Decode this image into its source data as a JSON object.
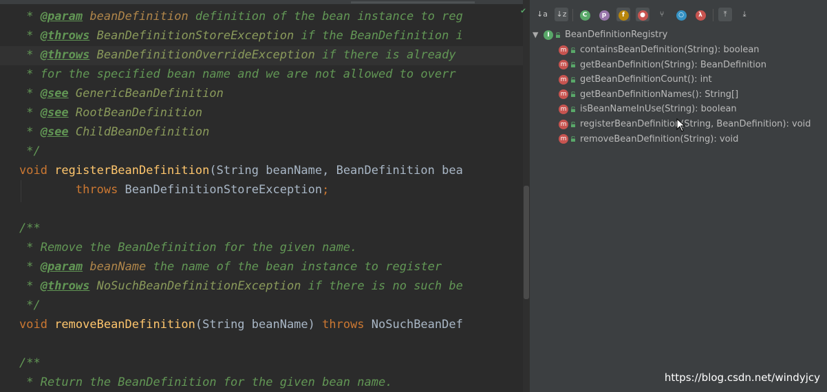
{
  "editor": {
    "lines": [
      {
        "parts": [
          {
            "c": "doc",
            "t": " * "
          },
          {
            "c": "tag",
            "t": "@param"
          },
          {
            "c": "doc",
            "t": " "
          },
          {
            "c": "param-name",
            "t": "beanDefinition"
          },
          {
            "c": "doc",
            "t": " definition of the bean instance to reg"
          }
        ]
      },
      {
        "parts": [
          {
            "c": "doc",
            "t": " * "
          },
          {
            "c": "tag",
            "t": "@throws"
          },
          {
            "c": "doc",
            "t": " "
          },
          {
            "c": "tagref",
            "t": "BeanDefinitionStoreException"
          },
          {
            "c": "doc",
            "t": " if the BeanDefinition i"
          }
        ]
      },
      {
        "parts": [
          {
            "c": "doc",
            "t": " * "
          },
          {
            "c": "tag",
            "t": "@throws"
          },
          {
            "c": "doc",
            "t": " "
          },
          {
            "c": "tagref",
            "t": "BeanDefinitionOverrideException"
          },
          {
            "c": "doc",
            "t": " if there is already"
          }
        ]
      },
      {
        "parts": [
          {
            "c": "doc",
            "t": " * for the specified bean name and we are not allowed to overr"
          }
        ]
      },
      {
        "parts": [
          {
            "c": "doc",
            "t": " * "
          },
          {
            "c": "tag",
            "t": "@see"
          },
          {
            "c": "doc",
            "t": " "
          },
          {
            "c": "tagref",
            "t": "GenericBeanDefinition"
          }
        ]
      },
      {
        "parts": [
          {
            "c": "doc",
            "t": " * "
          },
          {
            "c": "tag",
            "t": "@see"
          },
          {
            "c": "doc",
            "t": " "
          },
          {
            "c": "tagref",
            "t": "RootBeanDefinition"
          }
        ]
      },
      {
        "parts": [
          {
            "c": "doc",
            "t": " * "
          },
          {
            "c": "tag",
            "t": "@see"
          },
          {
            "c": "doc",
            "t": " "
          },
          {
            "c": "tagref",
            "t": "ChildBeanDefinition"
          }
        ]
      },
      {
        "parts": [
          {
            "c": "doc",
            "t": " */"
          }
        ]
      },
      {
        "parts": [
          {
            "c": "kw",
            "t": "void "
          },
          {
            "c": "fn",
            "t": "registerBeanDefinition"
          },
          {
            "c": "plain",
            "t": "(String beanName, BeanDefinition bea"
          }
        ]
      },
      {
        "parts": [
          {
            "c": "plain",
            "t": "        "
          },
          {
            "c": "kw",
            "t": "throws "
          },
          {
            "c": "plain",
            "t": "BeanDefinitionStoreException"
          },
          {
            "c": "kw",
            "t": ";"
          }
        ]
      },
      {
        "parts": [
          {
            "c": "plain",
            "t": ""
          }
        ]
      },
      {
        "parts": [
          {
            "c": "doc",
            "t": "/**"
          }
        ]
      },
      {
        "parts": [
          {
            "c": "doc",
            "t": " * Remove the BeanDefinition for the given name."
          }
        ]
      },
      {
        "parts": [
          {
            "c": "doc",
            "t": " * "
          },
          {
            "c": "tag",
            "t": "@param"
          },
          {
            "c": "doc",
            "t": " "
          },
          {
            "c": "param-name",
            "t": "beanName"
          },
          {
            "c": "doc",
            "t": " the name of the bean instance to register"
          }
        ]
      },
      {
        "parts": [
          {
            "c": "doc",
            "t": " * "
          },
          {
            "c": "tag",
            "t": "@throws"
          },
          {
            "c": "doc",
            "t": " "
          },
          {
            "c": "tagref",
            "t": "NoSuchBeanDefinitionException"
          },
          {
            "c": "doc",
            "t": " if there is no such be"
          }
        ]
      },
      {
        "parts": [
          {
            "c": "doc",
            "t": " */"
          }
        ]
      },
      {
        "parts": [
          {
            "c": "kw",
            "t": "void "
          },
          {
            "c": "fn",
            "t": "removeBeanDefinition"
          },
          {
            "c": "plain",
            "t": "(String beanName) "
          },
          {
            "c": "kw",
            "t": "throws "
          },
          {
            "c": "plain",
            "t": "NoSuchBeanDef"
          }
        ]
      },
      {
        "parts": [
          {
            "c": "plain",
            "t": ""
          }
        ]
      },
      {
        "parts": [
          {
            "c": "doc",
            "t": "/**"
          }
        ]
      },
      {
        "parts": [
          {
            "c": "doc",
            "t": " * Return the BeanDefinition for the given bean name."
          }
        ]
      }
    ]
  },
  "structure": {
    "root": {
      "label": "BeanDefinitionRegistry",
      "expanded_glyph": "▼",
      "icon": "interface-icon",
      "icon_letter": "I"
    },
    "method_icon_letter": "m",
    "items": [
      {
        "label": "containsBeanDefinition(String): boolean"
      },
      {
        "label": "getBeanDefinition(String): BeanDefinition"
      },
      {
        "label": "getBeanDefinitionCount(): int"
      },
      {
        "label": "getBeanDefinitionNames(): String[]"
      },
      {
        "label": "isBeanNameInUse(String): boolean"
      },
      {
        "label": "registerBeanDefinition(String, BeanDefinition): void"
      },
      {
        "label": "removeBeanDefinition(String): void"
      }
    ],
    "toolbar": {
      "buttons": [
        {
          "name": "sort-by-visibility-icon",
          "glyph": "↓a"
        },
        {
          "name": "sort-alphabetically-icon",
          "glyph": "↓z"
        },
        {
          "name": "show-inherited-icon",
          "glyph": "C",
          "color": "#59a869"
        },
        {
          "name": "show-properties-icon",
          "glyph": "p",
          "color": "#9876aa"
        },
        {
          "name": "show-fields-icon",
          "glyph": "f",
          "color": "#b8860b"
        },
        {
          "name": "show-non-public-icon",
          "glyph": "●",
          "color": "#c75450"
        },
        {
          "name": "show-lambdas-icon",
          "glyph": "⑂"
        },
        {
          "name": "show-anonymous-icon",
          "glyph": "○",
          "color": "#3592c4"
        },
        {
          "name": "show-lambda-icon",
          "glyph": "λ",
          "color": "#c75450"
        },
        {
          "name": "expand-all-icon",
          "glyph": "⤒"
        },
        {
          "name": "collapse-all-icon",
          "glyph": "⤓"
        }
      ]
    }
  },
  "watermark": "https://blog.csdn.net/windyjcy",
  "colors": {
    "editor_bg": "#2b2b2b",
    "panel_bg": "#3c3f41",
    "doc_comment": "#629755",
    "keyword": "#cc7832",
    "function": "#ffc66d"
  }
}
